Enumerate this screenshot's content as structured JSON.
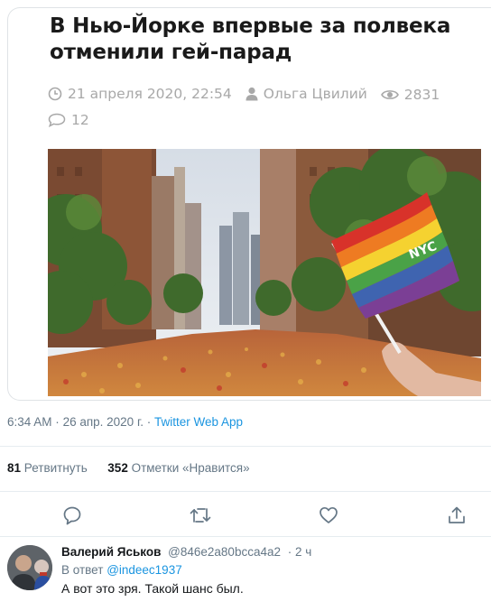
{
  "article": {
    "title_line1": "В Нью-Йорке впервые за полвека",
    "title_line2": "отменили гей-парад",
    "date": "21 апреля 2020, 22:54",
    "author": "Ольга Цвилий",
    "views": "2831",
    "comments": "12",
    "icons": [
      "clock-icon",
      "user-icon",
      "eye-icon",
      "comment-icon"
    ],
    "flag_text": "NYC"
  },
  "tweet": {
    "time": "6:34 AM",
    "date": "26 апр. 2020 г.",
    "separator": "·",
    "source": "Twitter Web App",
    "retweets_count": "81",
    "retweets_label": "Ретвитнуть",
    "likes_count": "352",
    "likes_label": "Отметки «Нравится»"
  },
  "actions": [
    "reply-icon",
    "retweet-icon",
    "like-icon",
    "share-icon"
  ],
  "reply": {
    "name": "Валерий Яськов",
    "handle": "@846e2a80bcca4a2",
    "time": "· 2 ч",
    "reply_to_label": "В ответ",
    "reply_to_handle": "@indeec1937",
    "text": "А вот это зря. Такой шанс был."
  },
  "colors": {
    "link": "#1b95e0",
    "secondary_text": "#657786",
    "meta_gray": "#a8a8a8",
    "divider": "#e6ecf0"
  }
}
